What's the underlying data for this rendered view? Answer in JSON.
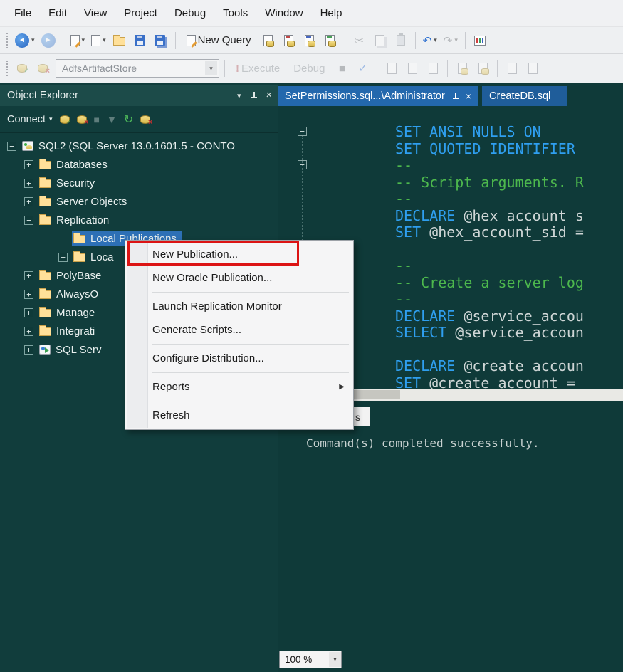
{
  "menu": {
    "items": [
      "File",
      "Edit",
      "View",
      "Project",
      "Debug",
      "Tools",
      "Window",
      "Help"
    ]
  },
  "toolbar_standard": {
    "new_query_label": "New Query"
  },
  "toolbar_sql": {
    "database_combo_value": "AdfsArtifactStore",
    "execute_label": "Execute",
    "debug_label": "Debug"
  },
  "object_explorer": {
    "title": "Object Explorer",
    "connect_label": "Connect",
    "tree": [
      {
        "label": "SQL2 (SQL Server 13.0.1601.5 - CONTO",
        "level": 0,
        "expander": "minus",
        "icon": "server",
        "selected": false
      },
      {
        "label": "Databases",
        "level": 1,
        "expander": "plus",
        "icon": "folder",
        "selected": false
      },
      {
        "label": "Security",
        "level": 1,
        "expander": "plus",
        "icon": "folder",
        "selected": false
      },
      {
        "label": "Server Objects",
        "level": 1,
        "expander": "plus",
        "icon": "folder",
        "selected": false
      },
      {
        "label": "Replication",
        "level": 1,
        "expander": "minus",
        "icon": "folder",
        "selected": false
      },
      {
        "label": "Local Publications",
        "level": 2,
        "expander": "none",
        "icon": "folder",
        "selected": true
      },
      {
        "label": "Loca",
        "level": 2,
        "expander": "plus",
        "icon": "folder",
        "selected": false
      },
      {
        "label": "PolyBase",
        "level": 1,
        "expander": "plus",
        "icon": "folder",
        "selected": false
      },
      {
        "label": "AlwaysO",
        "level": 1,
        "expander": "plus",
        "icon": "folder",
        "selected": false
      },
      {
        "label": "Manage",
        "level": 1,
        "expander": "plus",
        "icon": "folder",
        "selected": false
      },
      {
        "label": "Integrati",
        "level": 1,
        "expander": "plus",
        "icon": "folder",
        "selected": false
      },
      {
        "label": "SQL Serv",
        "level": 1,
        "expander": "plus",
        "icon": "agent",
        "selected": false
      }
    ]
  },
  "context_menu": {
    "items": [
      {
        "label": "New Publication...",
        "annotated": true
      },
      {
        "label": "New Oracle Publication..."
      },
      {
        "type": "separator"
      },
      {
        "label": "Launch Replication Monitor"
      },
      {
        "label": "Generate Scripts..."
      },
      {
        "type": "separator"
      },
      {
        "label": "Configure Distribution..."
      },
      {
        "type": "separator"
      },
      {
        "label": "Reports",
        "submenu": true
      },
      {
        "type": "separator"
      },
      {
        "label": "Refresh"
      }
    ]
  },
  "editor": {
    "tabs": [
      {
        "label": "SetPermissions.sql...\\Administrator",
        "active": true
      },
      {
        "label": "CreateDB.sql",
        "active": false
      }
    ],
    "zoom_value": "100 %",
    "fold_lines": [
      0,
      2
    ],
    "code": [
      [
        {
          "t": "SET ANSI_NULLS ON",
          "c": "kw"
        }
      ],
      [
        {
          "t": "SET QUOTED_IDENTIFIER",
          "c": "kw"
        }
      ],
      [
        {
          "t": "--",
          "c": "cm"
        }
      ],
      [
        {
          "t": "-- Script arguments. R",
          "c": "cm"
        }
      ],
      [
        {
          "t": "--",
          "c": "cm"
        }
      ],
      [
        {
          "t": "DECLARE ",
          "c": "kw"
        },
        {
          "t": "@hex_account_s",
          "c": "var"
        }
      ],
      [
        {
          "t": "SET ",
          "c": "kw"
        },
        {
          "t": "@hex_account_sid ",
          "c": "var"
        },
        {
          "t": "=",
          "c": "op"
        }
      ],
      [],
      [
        {
          "t": "--",
          "c": "cm"
        }
      ],
      [
        {
          "t": "-- Create a server log",
          "c": "cm"
        }
      ],
      [
        {
          "t": "--",
          "c": "cm"
        }
      ],
      [
        {
          "t": "DECLARE ",
          "c": "kw"
        },
        {
          "t": "@service_accou",
          "c": "var"
        }
      ],
      [
        {
          "t": "SELECT ",
          "c": "kw"
        },
        {
          "t": "@service_accoun",
          "c": "var"
        }
      ],
      [],
      [
        {
          "t": "DECLARE ",
          "c": "kw"
        },
        {
          "t": "@create_accoun",
          "c": "var"
        }
      ],
      [
        {
          "t": "SET ",
          "c": "kw"
        },
        {
          "t": "@create_account ",
          "c": "var"
        },
        {
          "t": "=",
          "c": "op"
        }
      ]
    ]
  },
  "messages": {
    "tab_label": "s",
    "text": "Command(s) completed successfully."
  },
  "icons": {
    "chevron-down": "▾",
    "nav-back": "◄",
    "nav-forward": "►",
    "undo": "↶",
    "redo": "↷",
    "refresh": "↻",
    "stop": "■",
    "close": "×",
    "submenu": "▶",
    "check": "✓",
    "filter": "▼",
    "exclamation": "!",
    "scissors": "✂"
  },
  "colors": {
    "selection": "#2d70b6",
    "tab_active": "#2368ad",
    "annotation_red": "#dc1414",
    "keyword": "#2f9ff0",
    "comment": "#4db84d",
    "variable": "#cfd6d6",
    "panel_bg": "#103c3b"
  }
}
